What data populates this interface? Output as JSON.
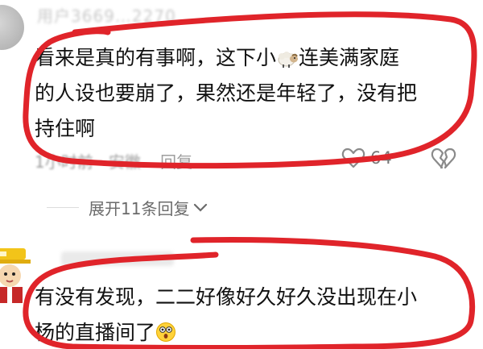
{
  "comment1": {
    "username": "用户3669…2270",
    "text_before_emoji": "看来是真的有事啊，这下小",
    "emoji_icon": "sheep-emoji",
    "text_after_emoji": "连美满家庭",
    "line2": "的人设也要崩了，果然还是年轻了，没有把",
    "line3": "持住啊",
    "time": "1小时前",
    "separator": "·",
    "location": "安徽",
    "reply_label": "回复",
    "like_count": "64"
  },
  "expand": {
    "label": "展开11条回复"
  },
  "comment2": {
    "line1": "有没有发现，二二好像好久好久没出现在小",
    "line2": "杨的直播间了",
    "emoji_icon": "astonished-face-emoji"
  },
  "colors": {
    "annotation_red": "#e0242a",
    "text": "#111111",
    "meta": "#9e9e9e"
  }
}
